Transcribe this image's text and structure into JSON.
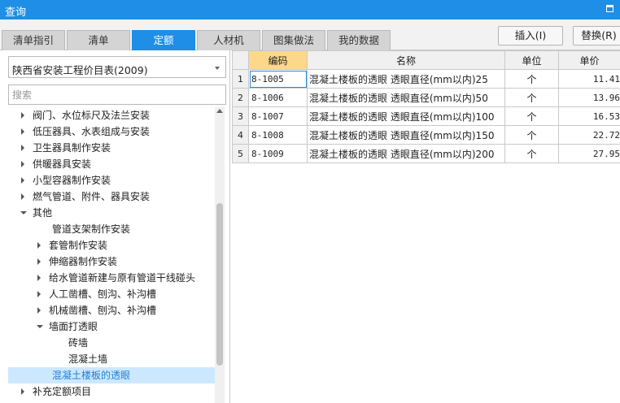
{
  "window": {
    "title": "查询"
  },
  "tabs": [
    {
      "label": "清单指引"
    },
    {
      "label": "清单"
    },
    {
      "label": "定额"
    },
    {
      "label": "人材机"
    },
    {
      "label": "图集做法"
    },
    {
      "label": "我的数据"
    }
  ],
  "active_tab": "定额",
  "buttons": {
    "insert": "插入(I)",
    "replace": "替换(R)"
  },
  "library_select": {
    "value": "陕西省安装工程价目表(2009)"
  },
  "search": {
    "placeholder": "搜索"
  },
  "tree": [
    {
      "label": "阀门、水位标尺及法兰安装",
      "level": 0,
      "state": "collapsed"
    },
    {
      "label": "低压器具、水表组成与安装",
      "level": 0,
      "state": "collapsed"
    },
    {
      "label": "卫生器具制作安装",
      "level": 0,
      "state": "collapsed"
    },
    {
      "label": "供暖器具安装",
      "level": 0,
      "state": "collapsed"
    },
    {
      "label": "小型容器制作安装",
      "level": 0,
      "state": "collapsed"
    },
    {
      "label": "燃气管道、附件、器具安装",
      "level": 0,
      "state": "collapsed"
    },
    {
      "label": "其他",
      "level": 0,
      "state": "expanded"
    },
    {
      "label": "管道支架制作安装",
      "level": 1,
      "state": "leaf"
    },
    {
      "label": "套管制作安装",
      "level": 1,
      "state": "collapsed"
    },
    {
      "label": "伸缩器制作安装",
      "level": 1,
      "state": "collapsed"
    },
    {
      "label": "给水管道新建与原有管道干线碰头",
      "level": 1,
      "state": "collapsed"
    },
    {
      "label": "人工凿槽、刨沟、补沟槽",
      "level": 1,
      "state": "collapsed"
    },
    {
      "label": "机械凿槽、刨沟、补沟槽",
      "level": 1,
      "state": "collapsed"
    },
    {
      "label": "墙面打透眼",
      "level": 1,
      "state": "expanded"
    },
    {
      "label": "砖墙",
      "level": 2,
      "state": "leaf"
    },
    {
      "label": "混凝土墙",
      "level": 2,
      "state": "leaf"
    },
    {
      "label": "混凝土楼板的透眼",
      "level": 1,
      "state": "leaf",
      "selected": true
    },
    {
      "label": "补充定额项目",
      "level": 0,
      "state": "collapsed"
    }
  ],
  "table": {
    "headers": {
      "code": "编码",
      "name": "名称",
      "unit": "单位",
      "price": "单价"
    },
    "rows": [
      {
        "index": "1",
        "code": "8-1005",
        "name": "混凝土楼板的透眼 透眼直径(mm以内)25",
        "unit": "个",
        "price": "11.41"
      },
      {
        "index": "2",
        "code": "8-1006",
        "name": "混凝土楼板的透眼 透眼直径(mm以内)50",
        "unit": "个",
        "price": "13.96"
      },
      {
        "index": "3",
        "code": "8-1007",
        "name": "混凝土楼板的透眼 透眼直径(mm以内)100",
        "unit": "个",
        "price": "16.53"
      },
      {
        "index": "4",
        "code": "8-1008",
        "name": "混凝土楼板的透眼 透眼直径(mm以内)150",
        "unit": "个",
        "price": "22.72"
      },
      {
        "index": "5",
        "code": "8-1009",
        "name": "混凝土楼板的透眼 透眼直径(mm以内)200",
        "unit": "个",
        "price": "27.95"
      }
    ]
  },
  "colors": {
    "accent": "#1e8ee6",
    "code_header": "#fdd88a",
    "selection": "#cce8ff"
  },
  "icons": {
    "maximize": "maximize-icon",
    "dropdown": "chevron-down-icon",
    "expand": "triangle-right-icon",
    "collapse": "triangle-down-icon"
  }
}
